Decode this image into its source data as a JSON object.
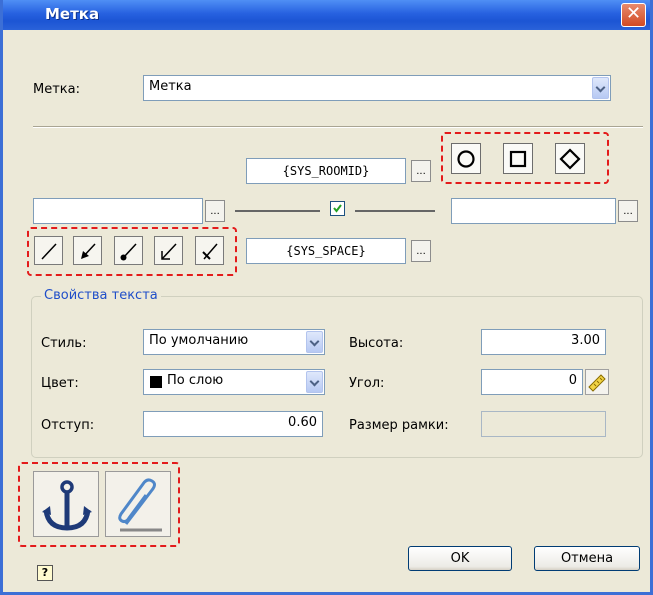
{
  "window": {
    "title": "Метка"
  },
  "tag": {
    "label": "Метка:",
    "value": "Метка"
  },
  "placeholders": {
    "top": "{SYS_ROOMID}",
    "bottom": "{SYS_SPACE}",
    "dots": "..."
  },
  "shapes": [
    "circle-icon",
    "square-icon",
    "diamond-icon"
  ],
  "leaders": [
    "line",
    "arrow",
    "dot",
    "open-arrow",
    "tick"
  ],
  "text_props": {
    "title": "Свойства текста",
    "style_label": "Стиль:",
    "style_value": "По умолчанию",
    "color_label": "Цвет:",
    "color_value": "По слою",
    "color_swatch": "#000000",
    "offset_label": "Отступ:",
    "offset_value": "0.60",
    "height_label": "Высота:",
    "height_value": "3.00",
    "angle_label": "Угол:",
    "angle_value": "0",
    "frame_label": "Размер рамки:",
    "frame_value": ""
  },
  "buttons": {
    "ok": "OK",
    "cancel": "Отмена",
    "help": "?"
  },
  "accent": {
    "highlight": "#e31b1b"
  }
}
